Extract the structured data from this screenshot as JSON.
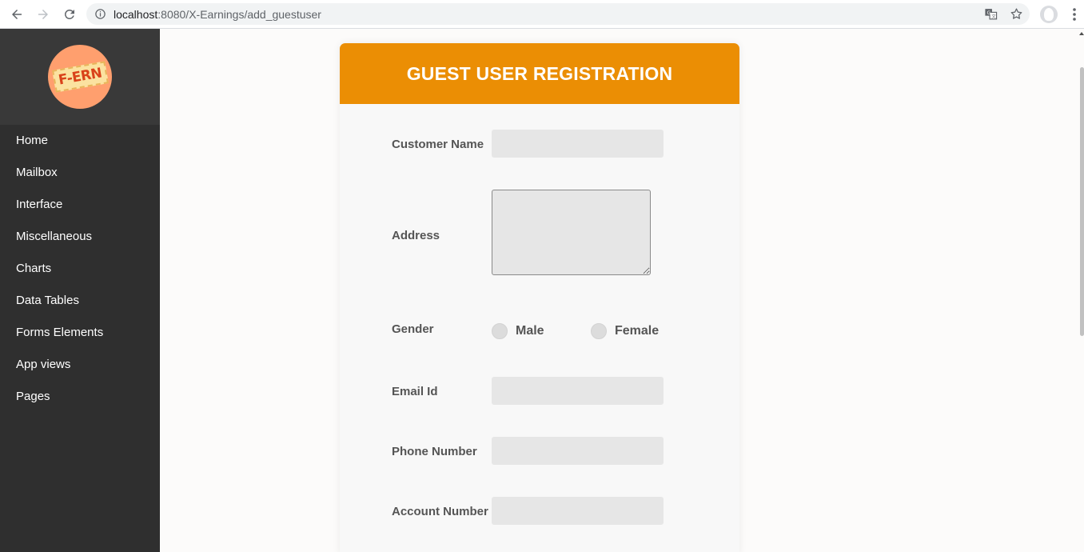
{
  "browser": {
    "url_host": "localhost",
    "url_path": ":8080/X-Earnings/add_guestuser",
    "icons": [
      "back-icon",
      "forward-icon",
      "reload-icon",
      "info-icon",
      "translate-icon",
      "star-icon",
      "profile-icon",
      "menu-icon"
    ]
  },
  "sidebar": {
    "logo_text": "F-ERN",
    "items": [
      {
        "label": "Home"
      },
      {
        "label": "Mailbox"
      },
      {
        "label": "Interface"
      },
      {
        "label": "Miscellaneous"
      },
      {
        "label": "Charts"
      },
      {
        "label": "Data Tables"
      },
      {
        "label": "Forms Elements"
      },
      {
        "label": "App views"
      },
      {
        "label": "Pages"
      }
    ]
  },
  "form": {
    "title": "GUEST USER REGISTRATION",
    "customer_name_label": "Customer Name",
    "customer_name_value": "",
    "address_label": "Address",
    "address_value": "",
    "gender_label": "Gender",
    "gender_options": [
      "Male",
      "Female"
    ],
    "email_label": "Email Id",
    "email_value": "",
    "phone_label": "Phone Number",
    "phone_value": "",
    "account_label": "Account Number",
    "account_value": ""
  },
  "colors": {
    "header_orange": "#eb8e04",
    "sidebar_bg": "#2f2f2f",
    "brand_bg": "#393939",
    "logo_circle": "#ff9f6e",
    "input_bg": "#e6e6e6",
    "label_text": "#555555"
  }
}
